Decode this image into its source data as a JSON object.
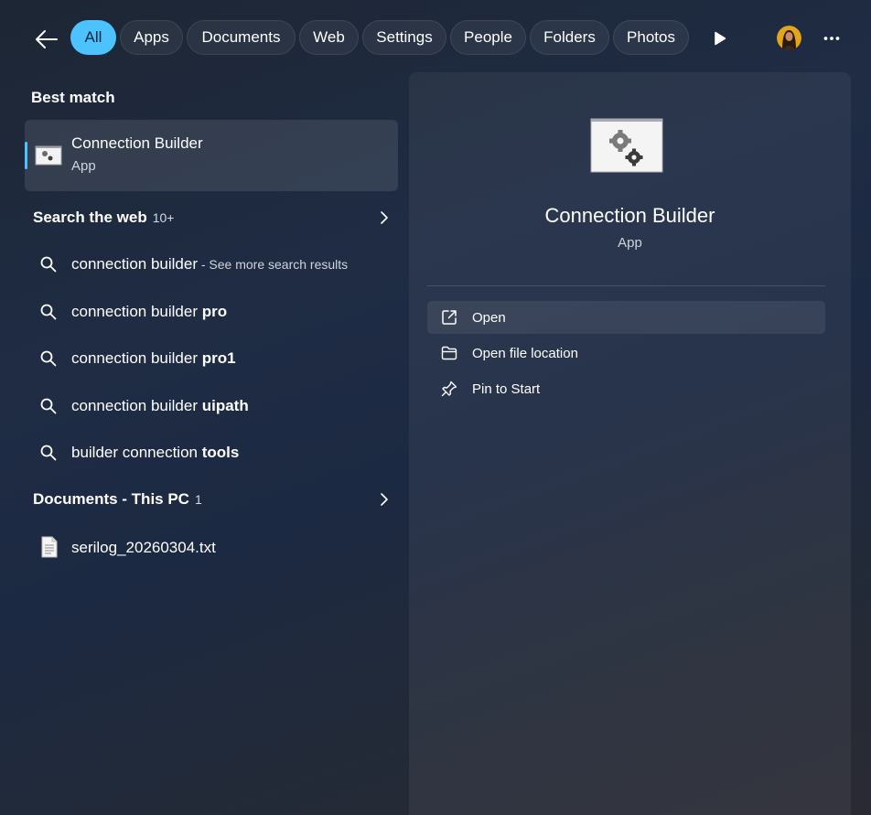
{
  "filters": [
    {
      "label": "All",
      "active": true
    },
    {
      "label": "Apps"
    },
    {
      "label": "Documents"
    },
    {
      "label": "Web"
    },
    {
      "label": "Settings"
    },
    {
      "label": "People"
    },
    {
      "label": "Folders"
    },
    {
      "label": "Photos"
    }
  ],
  "icons": {
    "back": "back-arrow-icon",
    "more_filters": "play-icon",
    "profile": "avatar",
    "more": "more-options-icon"
  },
  "best_match": {
    "heading": "Best match",
    "title": "Connection Builder",
    "subtitle": "App"
  },
  "web_section": {
    "title": "Search the web",
    "count": "10+",
    "items": [
      {
        "prefix": "connection builder",
        "bold": "",
        "hint": " - See more search results"
      },
      {
        "prefix": "connection builder ",
        "bold": "pro",
        "hint": ""
      },
      {
        "prefix": "connection builder ",
        "bold": "pro1",
        "hint": ""
      },
      {
        "prefix": "connection builder ",
        "bold": "uipath",
        "hint": ""
      },
      {
        "prefix": "builder connection ",
        "bold": "tools",
        "hint": ""
      }
    ]
  },
  "documents_section": {
    "title": "Documents - This PC",
    "count": "1",
    "items": [
      {
        "name": "serilog_20260304.txt"
      }
    ]
  },
  "details": {
    "app_name": "Connection Builder",
    "app_type": "App",
    "actions": [
      {
        "label": "Open",
        "icon": "open-external-icon"
      },
      {
        "label": "Open file location",
        "icon": "folder-icon"
      },
      {
        "label": "Pin to Start",
        "icon": "pin-icon"
      }
    ]
  },
  "colors": {
    "accent": "#4cc2ff"
  }
}
